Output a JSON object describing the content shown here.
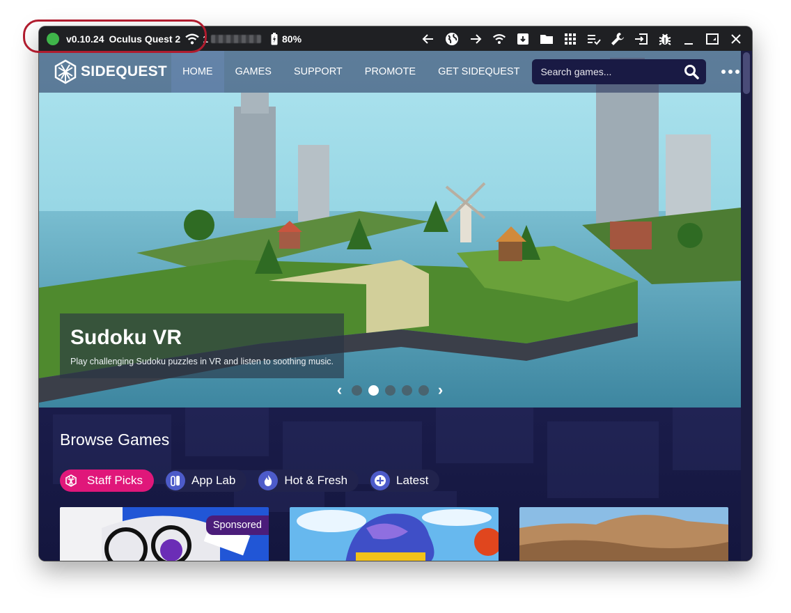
{
  "titlebar": {
    "version": "v0.10.24",
    "device": "Oculus Quest 2",
    "ip_prefix": "1",
    "battery": "80%",
    "status_color": "#3fb54a"
  },
  "toolbar_icons": [
    "back-arrow-icon",
    "globe-icon",
    "forward-arrow-icon",
    "wifi-icon",
    "archive-icon",
    "folder-icon",
    "grid-icon",
    "list-check-icon",
    "wrench-icon",
    "input-icon",
    "bug-icon",
    "minimize-icon",
    "window-icon",
    "close-icon"
  ],
  "nav": {
    "logo": "SIDEQUEST",
    "links": [
      "HOME",
      "GAMES",
      "SUPPORT",
      "PROMOTE",
      "GET SIDEQUEST"
    ],
    "active": "HOME",
    "search_placeholder": "Search games..."
  },
  "hero": {
    "title": "Sudoku VR",
    "subtitle": "Play challenging Sudoku puzzles in VR and listen to soothing music.",
    "slides": 5,
    "active_slide": 2
  },
  "browse": {
    "title": "Browse Games",
    "chips": [
      "Staff Picks",
      "App Lab",
      "Hot & Fresh",
      "Latest"
    ],
    "active_chip": "Staff Picks",
    "sponsored_label": "Sponsored"
  },
  "colors": {
    "accent_pink": "#e0177a",
    "chip_icon_blue": "#4d5bc9",
    "highlight_ring": "#b01c2e",
    "app_bg": "#151741"
  }
}
